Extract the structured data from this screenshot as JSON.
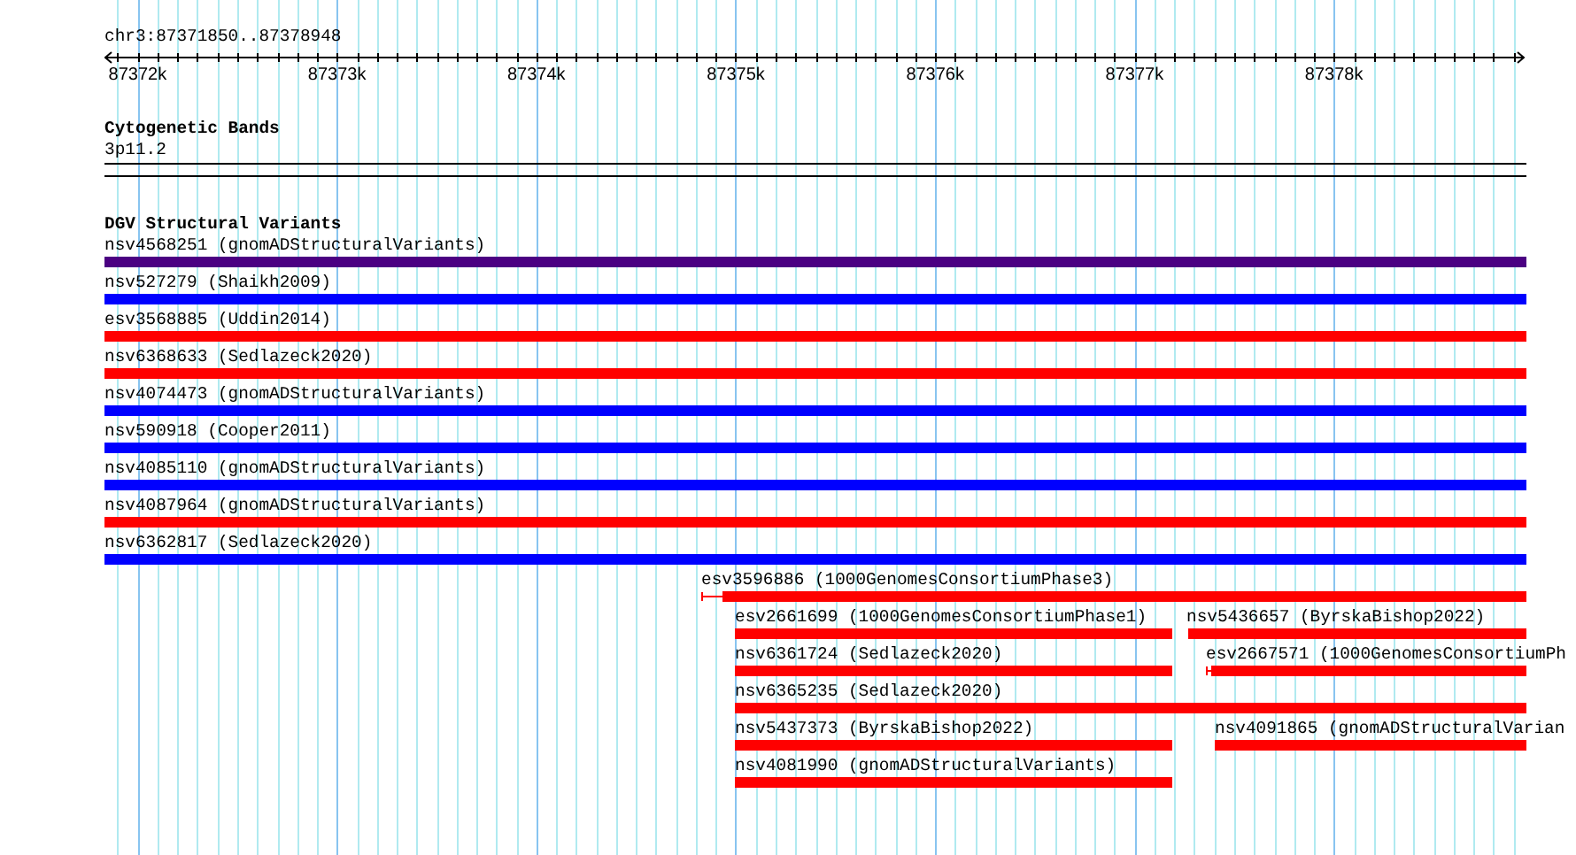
{
  "ruler": {
    "location": "chr3:87371850..87378948",
    "ticks": [
      "87372k",
      "87373k",
      "87374k",
      "87375k",
      "87376k",
      "87377k",
      "87378k"
    ]
  },
  "cytogenetic_bands": {
    "title": "Cytogenetic Bands",
    "band": {
      "label": "3p11.2"
    }
  },
  "dgv_track": {
    "title": "DGV Structural Variants",
    "lanes": [
      {
        "features": [
          {
            "label": "nsv4568251 (gnomADStructuralVariants)",
            "color": "#4b0082",
            "kind": "bar"
          }
        ]
      },
      {
        "features": [
          {
            "label": "nsv527279 (Shaikh2009)",
            "color": "#0000ff",
            "kind": "bar"
          }
        ]
      },
      {
        "features": [
          {
            "label": "esv3568885 (Uddin2014)",
            "color": "#ff0000",
            "kind": "bar"
          }
        ]
      },
      {
        "features": [
          {
            "label": "nsv6368633 (Sedlazeck2020)",
            "color": "#ff0000",
            "kind": "bar"
          }
        ]
      },
      {
        "features": [
          {
            "label": "nsv4074473 (gnomADStructuralVariants)",
            "color": "#0000ff",
            "kind": "bar"
          }
        ]
      },
      {
        "features": [
          {
            "label": "nsv590918 (Cooper2011)",
            "color": "#0000ff",
            "kind": "bar"
          }
        ]
      },
      {
        "features": [
          {
            "label": "nsv4085110 (gnomADStructuralVariants)",
            "color": "#0000ff",
            "kind": "bar"
          }
        ]
      },
      {
        "features": [
          {
            "label": "nsv4087964 (gnomADStructuralVariants)",
            "color": "#ff0000",
            "kind": "bar"
          }
        ]
      },
      {
        "features": [
          {
            "label": "nsv6362817 (Sedlazeck2020)",
            "color": "#0000ff",
            "kind": "bar"
          }
        ]
      },
      {
        "features": [
          {
            "label": "esv3596886 (1000GenomesConsortiumPhase3)",
            "color": "#ff0000",
            "kind": "whisker"
          }
        ]
      },
      {
        "features": [
          {
            "label": "esv2661699 (1000GenomesConsortiumPhase1)",
            "color": "#ff0000",
            "kind": "bar"
          },
          {
            "label": "nsv5436657 (ByrskaBishop2022)",
            "color": "#ff0000",
            "kind": "bar"
          }
        ]
      },
      {
        "features": [
          {
            "label": "nsv6361724 (Sedlazeck2020)",
            "color": "#ff0000",
            "kind": "bar"
          },
          {
            "label": "esv2667571 (1000GenomesConsortiumPh",
            "color": "#ff0000",
            "kind": "whisker"
          }
        ]
      },
      {
        "features": [
          {
            "label": "nsv6365235 (Sedlazeck2020)",
            "color": "#ff0000",
            "kind": "bar"
          }
        ]
      },
      {
        "features": [
          {
            "label": "nsv5437373 (ByrskaBishop2022)",
            "color": "#ff0000",
            "kind": "bar"
          },
          {
            "label": "nsv4091865 (gnomADStructuralVarian",
            "color": "#ff0000",
            "kind": "bar"
          }
        ]
      },
      {
        "features": [
          {
            "label": "nsv4081990 (gnomADStructuralVariants)",
            "color": "#ff0000",
            "kind": "bar"
          }
        ]
      }
    ]
  }
}
